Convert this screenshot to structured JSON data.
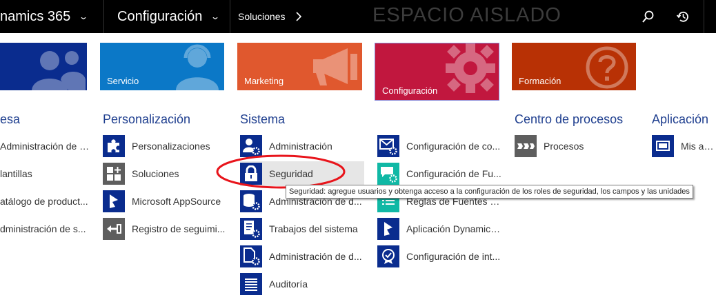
{
  "topbar": {
    "app_title": "namics 365",
    "area_title": "Configuración",
    "breadcrumb": "Soluciones",
    "sandbox_label": "ESPACIO AISLADO"
  },
  "tiles": [
    {
      "label": "",
      "color": "#0a2c8e",
      "icon": "people-icon"
    },
    {
      "label": "Servicio",
      "color": "#0b78c7",
      "icon": "headset-person-icon"
    },
    {
      "label": "Marketing",
      "color": "#e0582e",
      "icon": "megaphone-icon"
    },
    {
      "label": "Configuración",
      "color": "#c1173e",
      "icon": "gear-icon",
      "selected": true
    },
    {
      "label": "Formación",
      "color": "#b83105",
      "icon": "help-icon"
    }
  ],
  "sections": {
    "empresa": {
      "title": "esa",
      "items": [
        "Administración de e...",
        "lantillas",
        "atálogo de product...",
        "dministración de s..."
      ]
    },
    "personalizacion": {
      "title": "Personalización",
      "items": [
        "Personalizaciones",
        "Soluciones",
        "Microsoft AppSource",
        "Registro de seguimi..."
      ]
    },
    "sistema": {
      "title": "Sistema",
      "col1": [
        "Administración",
        "Seguridad",
        "Administración de d...",
        "Trabajos del sistema",
        "Administración de d...",
        "Auditoría"
      ],
      "col2": [
        "Configuración de co...",
        "Configuración de Fu...",
        "Reglas de Fuentes d...",
        "Aplicación Dynamics...",
        "Configuración de int..."
      ]
    },
    "procesos": {
      "title": "Centro de procesos",
      "items": [
        "Procesos"
      ]
    },
    "aplicaciones": {
      "title": "Aplicación",
      "items": [
        "Mis aplic"
      ]
    }
  },
  "tooltip": "Seguridad: agregue usuarios y obtenga acceso a la configuración de los roles de seguridad, los campos y las unidades",
  "annotation_color": "#e8141b"
}
